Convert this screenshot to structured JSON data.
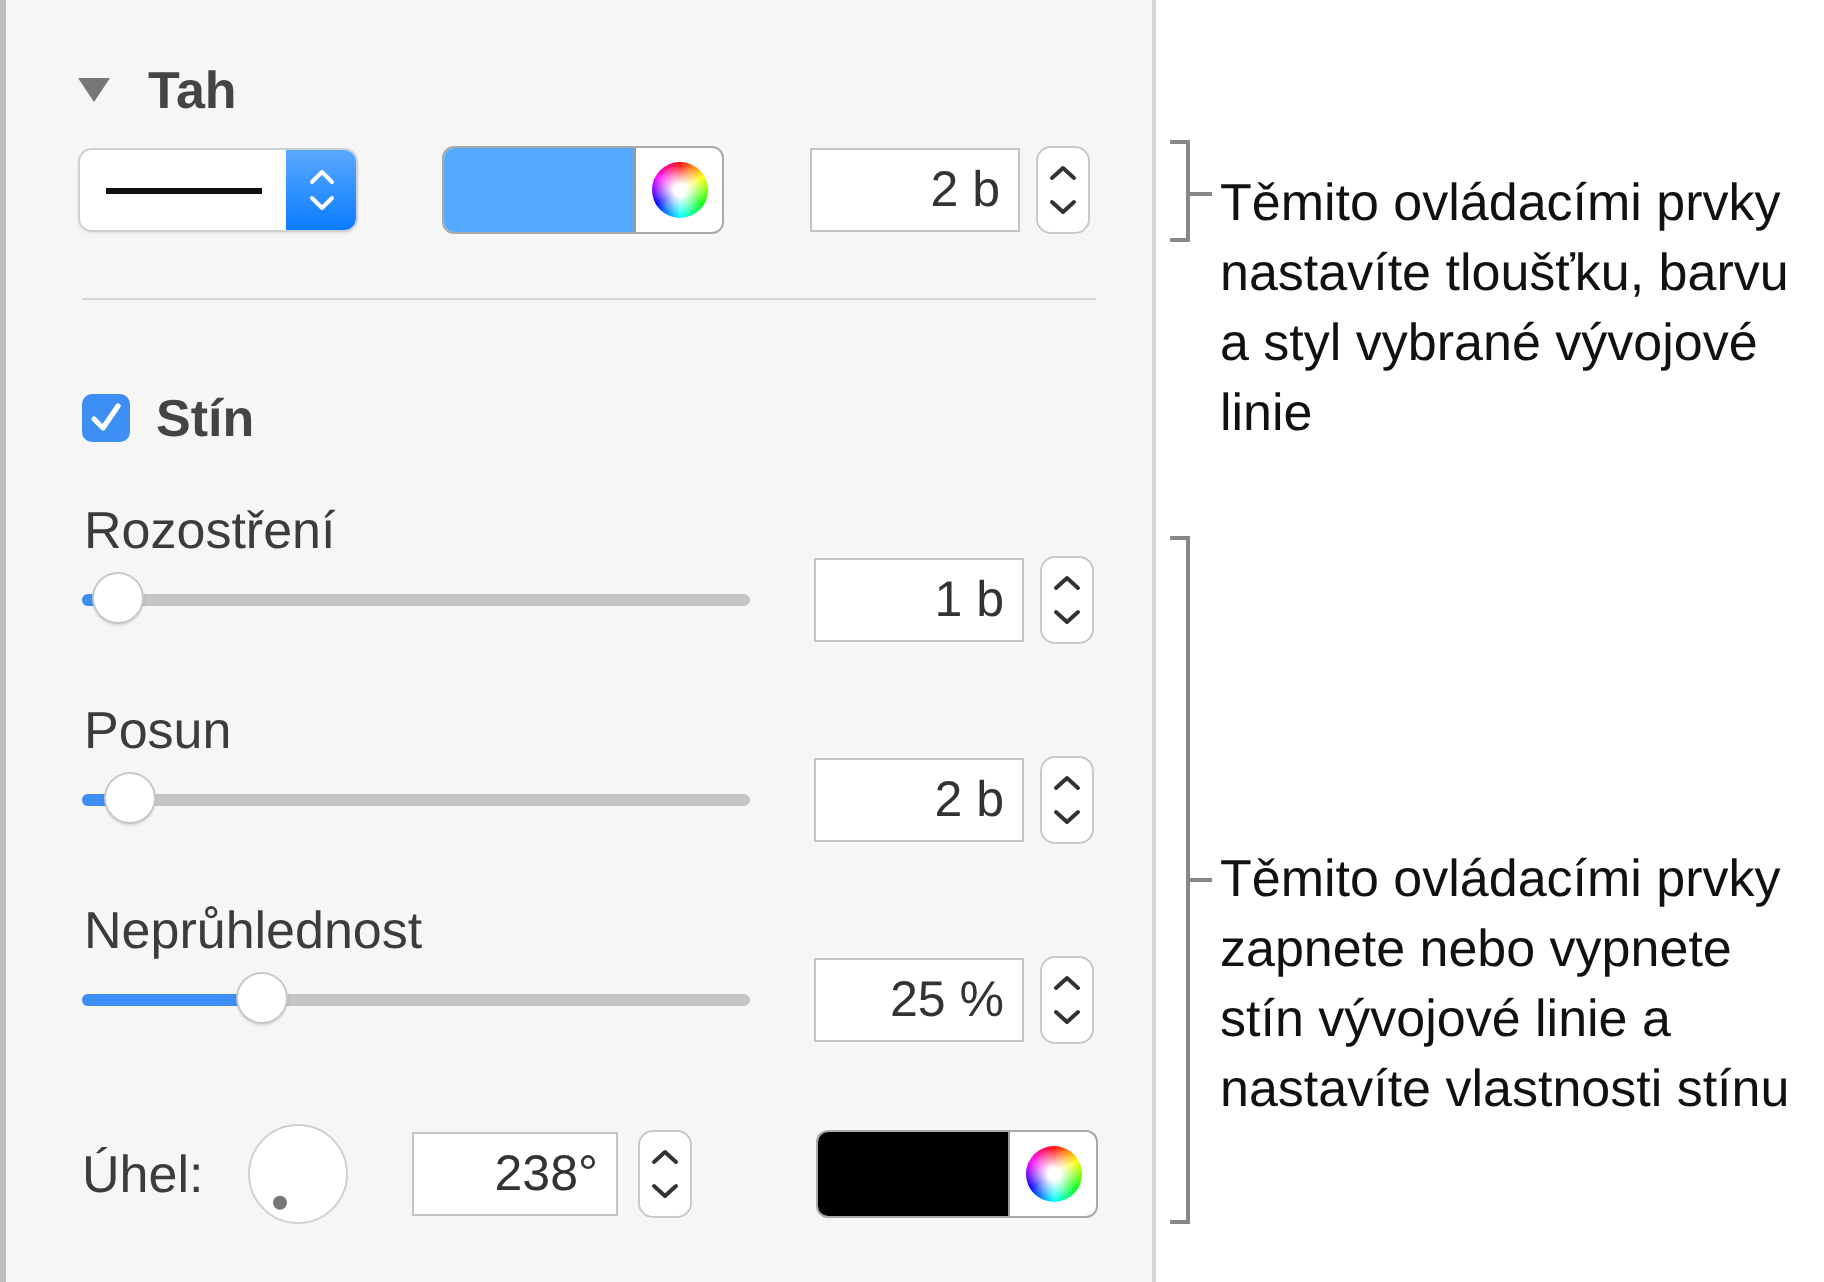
{
  "stroke": {
    "title": "Tah",
    "expanded": true,
    "color": "#55aaff",
    "width": "2 b"
  },
  "shadow": {
    "label": "Stín",
    "checked": true,
    "controls": [
      {
        "label": "Rozostření",
        "level": 0.02,
        "value": "1 b"
      },
      {
        "label": "Posun",
        "level": 0.04,
        "value": "2 b"
      },
      {
        "label": "Neprůhlednost",
        "level": 0.25,
        "value": "25 %"
      }
    ],
    "angle": {
      "label": "Úhel:",
      "value": "238°"
    },
    "color": "#000000"
  },
  "callouts": [
    {
      "text": "Těmito ovládacími prvky nastavíte tloušťku, barvu a styl vybrané vývojové linie"
    },
    {
      "text": "Těmito ovládacími prvky zapnete nebo vypnete stín vývojové linie a nastavíte vlastnosti stínu"
    }
  ]
}
